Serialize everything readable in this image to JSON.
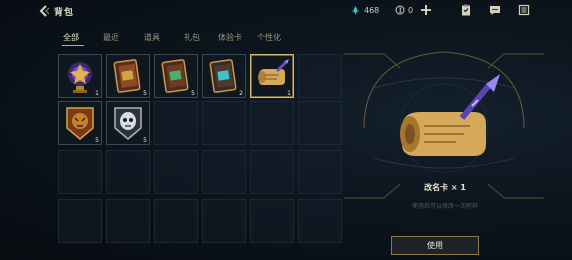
{
  "header": {
    "title": "背包",
    "currency_1_value": "468",
    "currency_2_value": "0"
  },
  "tabs": [
    {
      "label": "全部",
      "active": true
    },
    {
      "label": "最近",
      "active": false
    },
    {
      "label": "道具",
      "active": false
    },
    {
      "label": "礼包",
      "active": false
    },
    {
      "label": "体验卡",
      "active": false
    },
    {
      "label": "个性化",
      "active": false
    }
  ],
  "items": [
    {
      "icon": "trophy-orb-icon",
      "count": "1"
    },
    {
      "icon": "gold-chest-card-icon",
      "count": "5"
    },
    {
      "icon": "green-chest-card-icon",
      "count": "5"
    },
    {
      "icon": "teal-chest-card-icon",
      "count": "2"
    },
    {
      "icon": "name-change-scroll-icon",
      "count": "1",
      "selected": true
    },
    {
      "icon": "gold-lion-emblem-icon",
      "count": "5"
    },
    {
      "icon": "silver-skull-emblem-icon",
      "count": "5"
    }
  ],
  "detail": {
    "name": "改名卡  × 1",
    "description": "使用后可以修改一次昵称",
    "use_label": "使用"
  },
  "colors": {
    "accent_gold": "#c8aa6e",
    "teal": "#4fd1d9",
    "background": "#0a1118"
  }
}
